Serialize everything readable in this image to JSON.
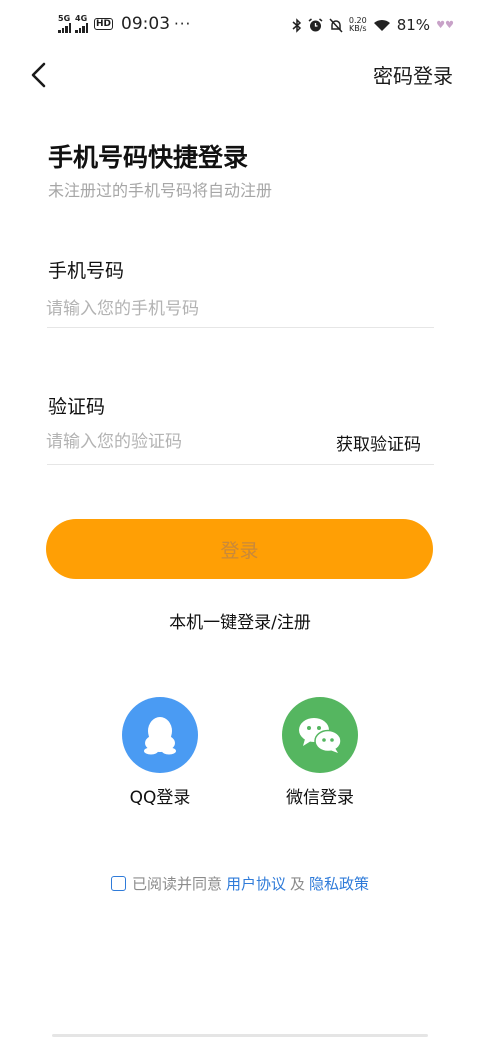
{
  "status_bar": {
    "sim1": "5G",
    "sim2": "4G",
    "hd": "HD",
    "time": "09:03",
    "more": "···",
    "net_speed_value": "0.20",
    "net_speed_unit": "KB/s",
    "battery": "81%"
  },
  "nav": {
    "back_icon": "chevron-left-icon",
    "password_login": "密码登录"
  },
  "header": {
    "title": "手机号码快捷登录",
    "subtitle": "未注册过的手机号码将自动注册"
  },
  "form": {
    "phone_label": "手机号码",
    "phone_value": "",
    "phone_placeholder": "请输入您的手机号码",
    "code_label": "验证码",
    "code_value": "",
    "code_placeholder": "请输入您的验证码",
    "get_code": "获取验证码"
  },
  "actions": {
    "login": "登录",
    "one_click": "本机一键登录/注册"
  },
  "social": {
    "qq_label": "QQ登录",
    "qq_icon": "qq-penguin-icon",
    "wechat_label": "微信登录",
    "wechat_icon": "wechat-bubbles-icon"
  },
  "agreement": {
    "prefix": "已阅读并同意",
    "user_agreement": "用户协议",
    "and": "及",
    "privacy_policy": "隐私政策"
  },
  "colors": {
    "primary_button": "#ff9f05",
    "qq_blue": "#4a9bf3",
    "wechat_green": "#55b660",
    "link_blue": "#2f7bd9"
  }
}
